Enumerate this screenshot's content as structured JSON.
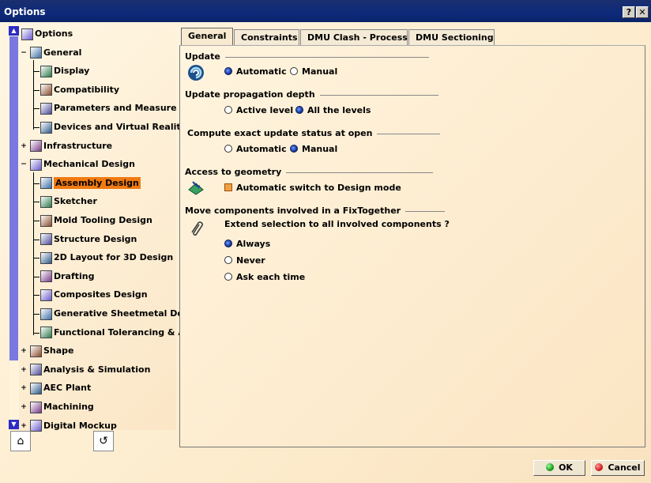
{
  "window": {
    "title": "Options",
    "help_glyph": "?",
    "close_glyph": "✕"
  },
  "tree": [
    {
      "label": "Options",
      "level": 0,
      "icon": "options-icon"
    },
    {
      "label": "General",
      "level": 1,
      "icon": "general-icon"
    },
    {
      "label": "Display",
      "level": 2,
      "icon": "display-icon"
    },
    {
      "label": "Compatibility",
      "level": 2,
      "icon": "compatibility-icon"
    },
    {
      "label": "Parameters and Measure",
      "level": 2,
      "icon": "parameters-icon"
    },
    {
      "label": "Devices and Virtual Reality",
      "level": 2,
      "icon": "devices-icon"
    },
    {
      "label": "Infrastructure",
      "level": 1,
      "icon": "infrastructure-icon"
    },
    {
      "label": "Mechanical Design",
      "level": 1,
      "icon": "mechanical-design-icon"
    },
    {
      "label": "Assembly Design",
      "level": 2,
      "icon": "assembly-design-icon",
      "selected": true
    },
    {
      "label": "Sketcher",
      "level": 2,
      "icon": "sketcher-icon"
    },
    {
      "label": "Mold Tooling Design",
      "level": 2,
      "icon": "mold-tooling-icon"
    },
    {
      "label": "Structure Design",
      "level": 2,
      "icon": "structure-design-icon"
    },
    {
      "label": "2D Layout for 3D Design",
      "level": 2,
      "icon": "layout-2d-icon"
    },
    {
      "label": "Drafting",
      "level": 2,
      "icon": "drafting-icon"
    },
    {
      "label": "Composites Design",
      "level": 2,
      "icon": "composites-icon"
    },
    {
      "label": "Generative Sheetmetal Des",
      "level": 2,
      "icon": "sheetmetal-icon"
    },
    {
      "label": "Functional Tolerancing & Ar",
      "level": 2,
      "icon": "tolerancing-icon"
    },
    {
      "label": "Shape",
      "level": 1,
      "icon": "shape-icon"
    },
    {
      "label": "Analysis & Simulation",
      "level": 1,
      "icon": "analysis-icon"
    },
    {
      "label": "AEC Plant",
      "level": 1,
      "icon": "aec-plant-icon"
    },
    {
      "label": "Machining",
      "level": 1,
      "icon": "machining-icon"
    },
    {
      "label": "Digital Mockup",
      "level": 1,
      "icon": "digital-mockup-icon"
    }
  ],
  "tabs": [
    {
      "label": "General",
      "active": true
    },
    {
      "label": "Constraints"
    },
    {
      "label": "DMU Clash - Process"
    },
    {
      "label": "DMU Sectioning"
    }
  ],
  "sections": {
    "update": {
      "title": "Update",
      "options": [
        {
          "label": "Automatic",
          "checked": true
        },
        {
          "label": "Manual",
          "checked": false
        }
      ]
    },
    "depth": {
      "title": "Update propagation depth",
      "options": [
        {
          "label": "Active level",
          "checked": false
        },
        {
          "label": "All the levels",
          "checked": true
        }
      ]
    },
    "exact": {
      "title": "Compute exact update status at open",
      "options": [
        {
          "label": "Automatic",
          "checked": false
        },
        {
          "label": "Manual",
          "checked": true
        }
      ]
    },
    "geometry": {
      "title": "Access to geometry",
      "checkbox_label": "Automatic switch to Design mode",
      "checked": true
    },
    "fixtogether": {
      "title": "Move components involved in a FixTogether",
      "question": "Extend selection to all involved components ?",
      "options": [
        {
          "label": "Always",
          "checked": true
        },
        {
          "label": "Never",
          "checked": false
        },
        {
          "label": "Ask each time",
          "checked": false
        }
      ]
    }
  },
  "buttons": {
    "ok": "OK",
    "cancel": "Cancel"
  },
  "colors": {
    "selection": "#f07a12",
    "titlebar": "#0e2a7a",
    "ok_dot": "#1a9a1a",
    "cancel_dot": "#d02020"
  }
}
